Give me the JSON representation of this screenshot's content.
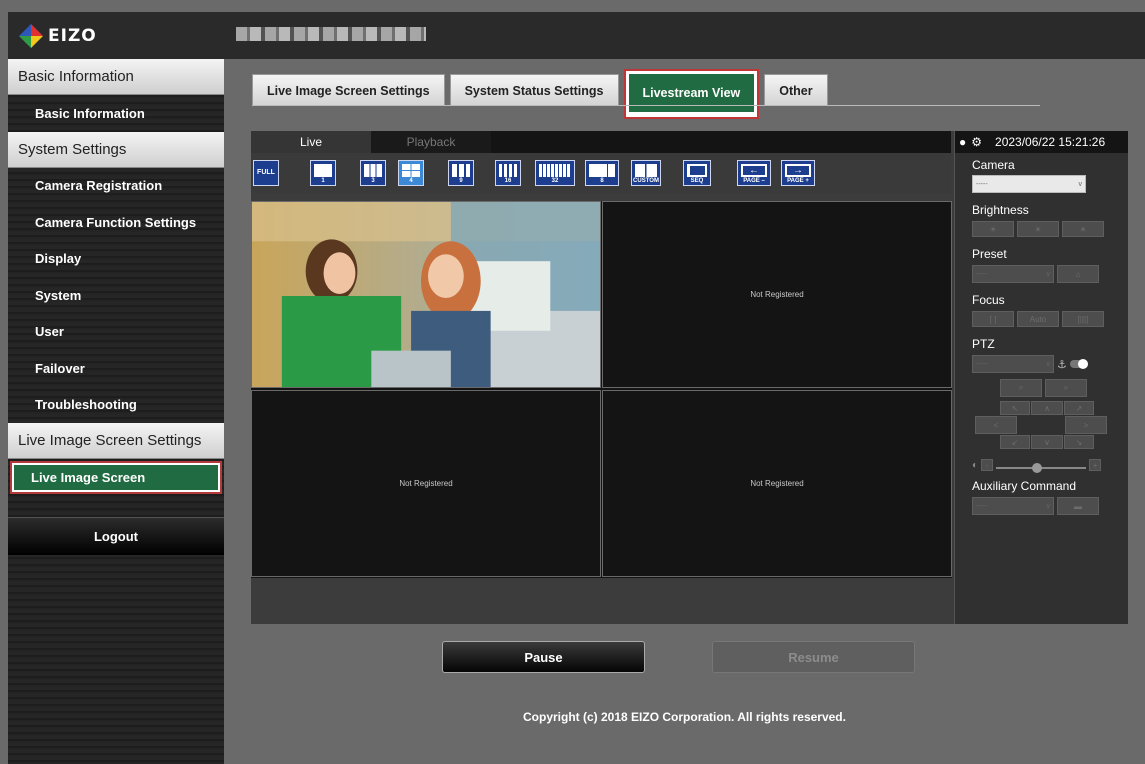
{
  "header": {
    "logo_text": "EIZO"
  },
  "sidebar": {
    "sections": [
      {
        "header": "Basic Information",
        "items": [
          "Basic Information"
        ]
      },
      {
        "header": "System Settings",
        "items": [
          "Camera Registration",
          "Camera Function Settings",
          "Display",
          "System",
          "User",
          "Failover",
          "Troubleshooting"
        ]
      },
      {
        "header": "Live Image Screen Settings",
        "items": [
          "Live Image Screen"
        ]
      }
    ],
    "logout_label": "Logout"
  },
  "tabs": [
    "Live Image Screen Settings",
    "System Status Settings",
    "Livestream View",
    "Other"
  ],
  "viewer": {
    "live_tab": "Live",
    "playback_tab": "Playback",
    "toolbar": [
      "FULL",
      "1",
      "3",
      "4",
      "9",
      "16",
      "32",
      "8",
      "CUSTOM",
      "SEQ",
      "PAGE –",
      "PAGE +"
    ],
    "cells": [
      "Not Registered",
      "Not Registered",
      "Not Registered"
    ]
  },
  "panel": {
    "datetime": "2023/06/22 15:21:26",
    "camera_label": "Camera",
    "camera_value": "-----",
    "brightness_label": "Brightness",
    "preset_label": "Preset",
    "preset_value": "-----",
    "focus_label": "Focus",
    "focus_auto": "Auto",
    "ptz_label": "PTZ",
    "ptz_value": "-----",
    "aux_label": "Auxiliary Command",
    "aux_value": "-----"
  },
  "buttons": {
    "pause": "Pause",
    "resume": "Resume"
  },
  "footer": {
    "copyright": "Copyright (c) 2018 EIZO Corporation. All rights reserved."
  },
  "colors": {
    "active_green": "#206b41",
    "highlight_red": "#c03535",
    "toolbar_blue": "#1d3e8e"
  }
}
